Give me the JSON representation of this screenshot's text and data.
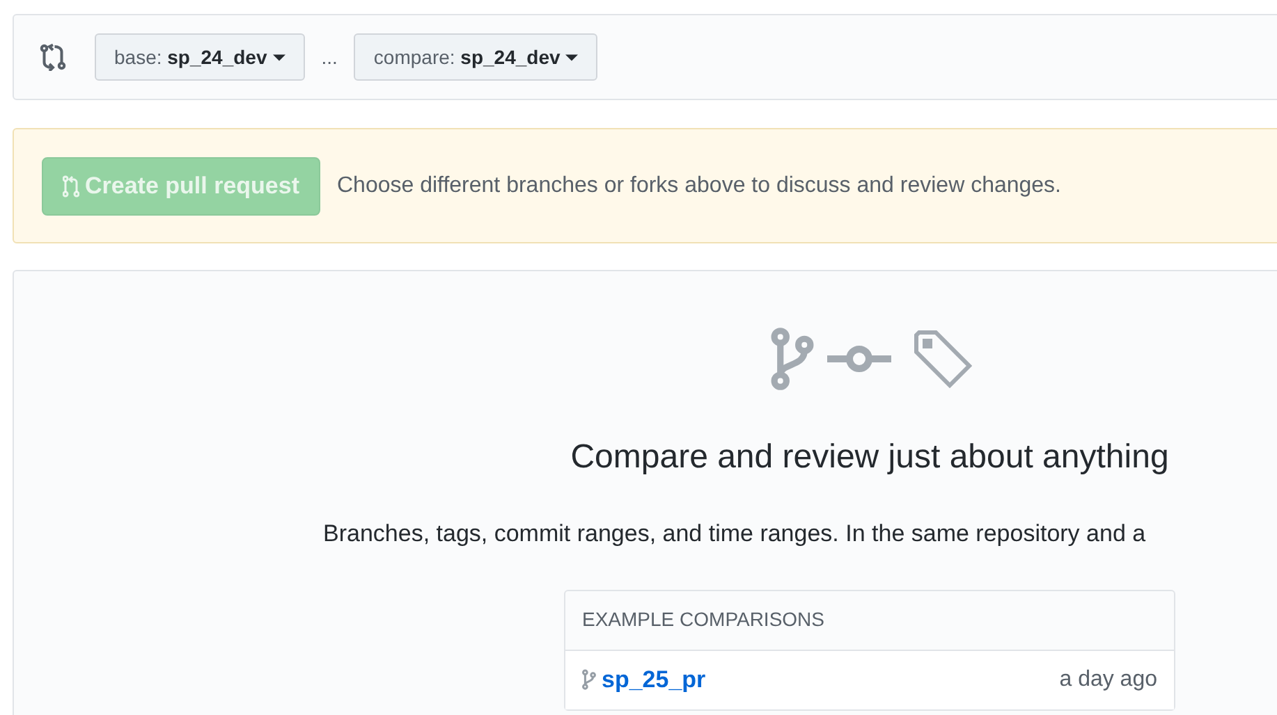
{
  "range_bar": {
    "base": {
      "label": "base:",
      "branch": "sp_24_dev"
    },
    "separator": "...",
    "compare": {
      "label": "compare:",
      "branch": "sp_24_dev"
    }
  },
  "notice": {
    "button": {
      "label": "Create pull request",
      "disabled": true
    },
    "message": "Choose different branches or forks above to discuss and review changes."
  },
  "blankslate": {
    "heading": "Compare and review just about anything",
    "description": "Branches, tags, commit ranges, and time ranges. In the same repository and a",
    "examples": {
      "header": "EXAMPLE COMPARISONS",
      "rows": [
        {
          "branch": "sp_25_pr",
          "time": "a day ago"
        }
      ]
    }
  }
}
